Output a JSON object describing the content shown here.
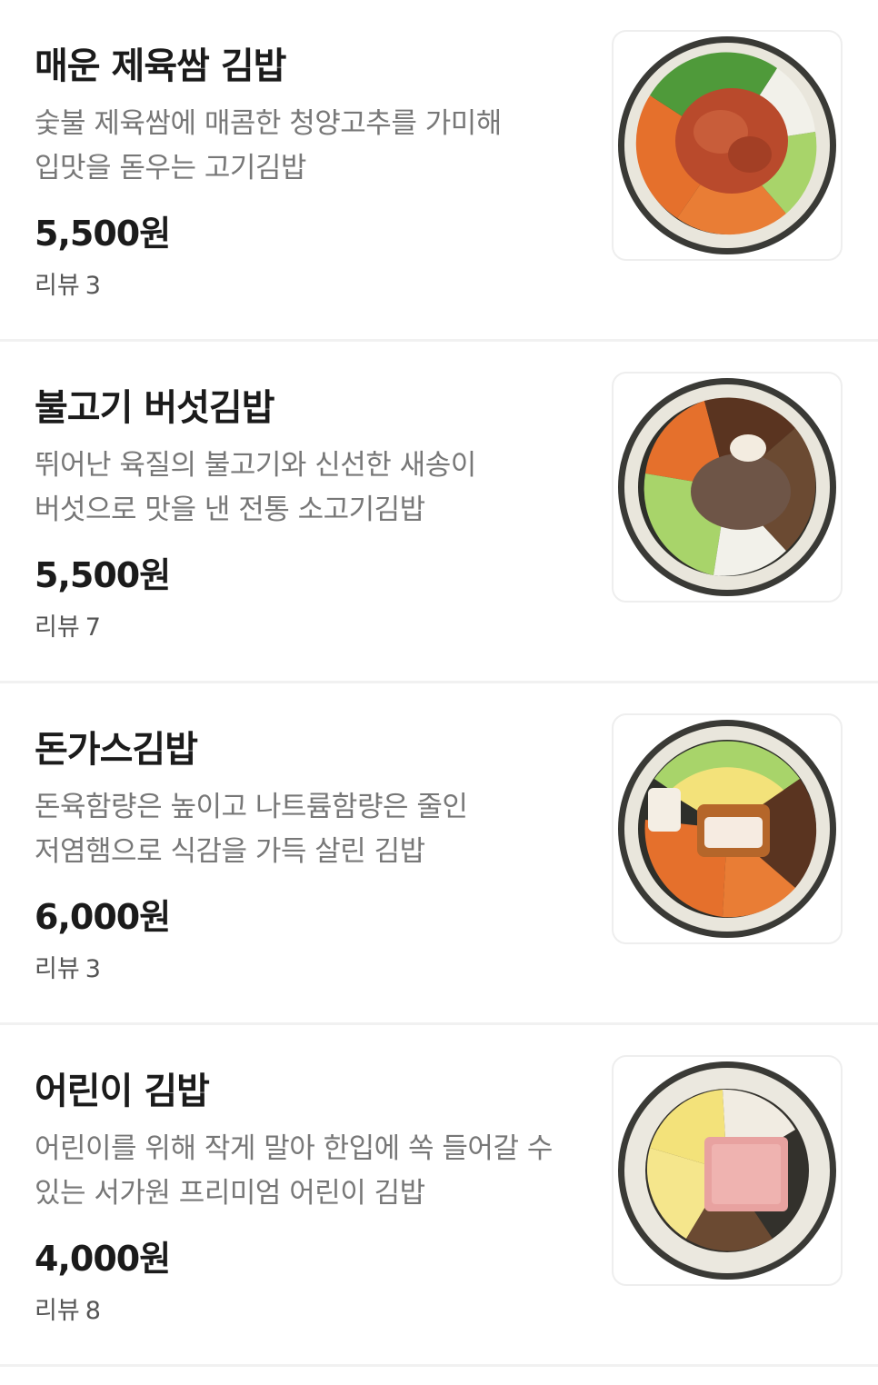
{
  "menu": {
    "items": [
      {
        "name": "매운 제육쌈 김밥",
        "desc_line1": "숯불 제육쌈에 매콤한 청양고추를 가미해",
        "desc_line2": "입맛을 돋우는 고기김밥",
        "price": "5,500원",
        "review_label": "리뷰",
        "review_count": "3",
        "image_icon": "spicy-pork-kimbap-image"
      },
      {
        "name": "불고기 버섯김밥",
        "desc_line1": "뛰어난 육질의 불고기와 신선한 새송이",
        "desc_line2": "버섯으로 맛을 낸 전통 소고기김밥",
        "price": "5,500원",
        "review_label": "리뷰",
        "review_count": "7",
        "image_icon": "bulgogi-mushroom-kimbap-image"
      },
      {
        "name": "돈가스김밥",
        "desc_line1": "돈육함량은 높이고 나트륨함량은 줄인",
        "desc_line2": "저염햄으로 식감을 가득 살린 김밥",
        "price": "6,000원",
        "review_label": "리뷰",
        "review_count": "3",
        "image_icon": "pork-cutlet-kimbap-image"
      },
      {
        "name": "어린이 김밥",
        "desc_line1": "어린이를 위해 작게 말아 한입에 쏙 들어갈 수",
        "desc_line2": "있는 서가원 프리미엄 어린이 김밥",
        "price": "4,000원",
        "review_label": "리뷰",
        "review_count": "8",
        "image_icon": "kids-kimbap-image"
      }
    ]
  }
}
